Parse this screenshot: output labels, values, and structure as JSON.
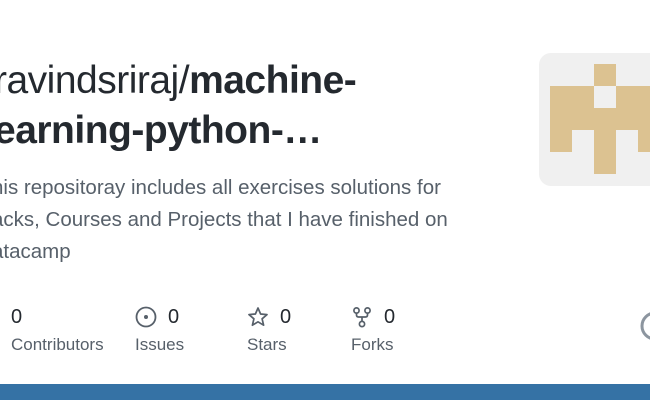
{
  "repo": {
    "owner_display": "ravindsriraj/",
    "name_line1": "machine-",
    "name_line2": "earning-python-…"
  },
  "description": {
    "line1": "his repositoray includes all exercises solutions for",
    "line2": "acks, Courses and Projects that I have finished on",
    "line3": "atacamp"
  },
  "stats": {
    "contributors": {
      "count": "0",
      "label": "Contributors",
      "icon": "people-icon"
    },
    "issues": {
      "count": "0",
      "label": "Issues",
      "icon": "issue-icon"
    },
    "stars": {
      "count": "0",
      "label": "Stars",
      "icon": "star-icon"
    },
    "forks": {
      "count": "0",
      "label": "Forks",
      "icon": "fork-icon"
    }
  },
  "colors": {
    "title": "#24292f",
    "muted": "#57606a",
    "avatar_fill": "#dcc291",
    "avatar_bg": "#f0f0f0",
    "language_bar": "#3572a5"
  }
}
